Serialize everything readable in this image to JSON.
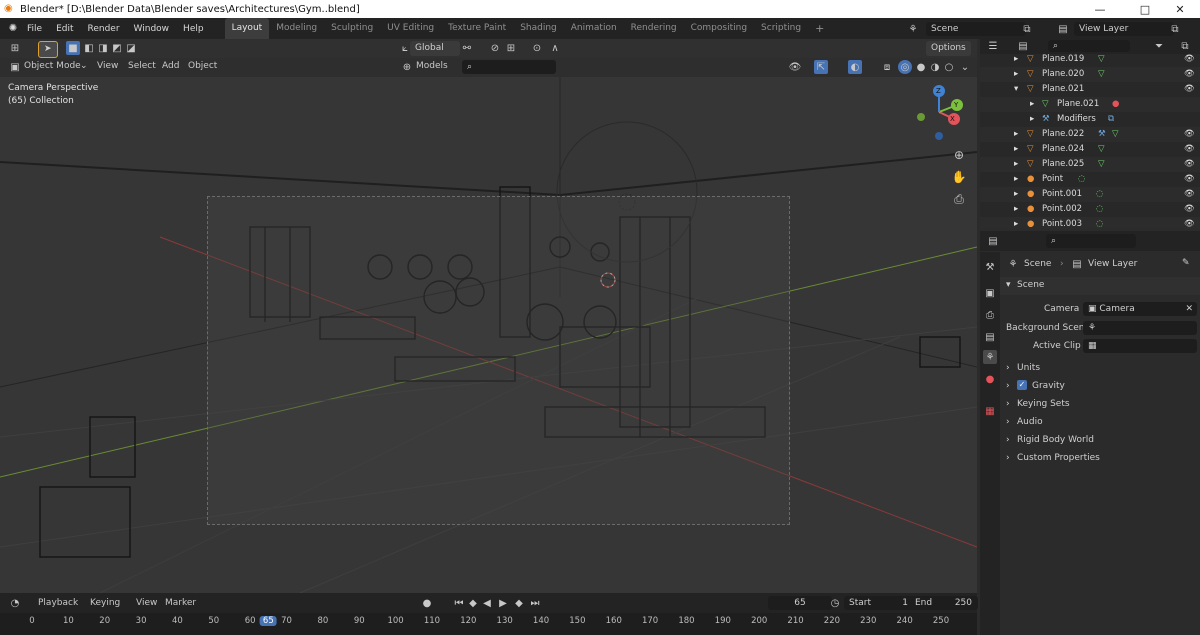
{
  "window": {
    "title": "Blender* [D:\\Blender Data\\Blender saves\\Architectures\\Gym..blend]",
    "min": "—",
    "max": "□",
    "close": "✕"
  },
  "menu": {
    "items": [
      "File",
      "Edit",
      "Render",
      "Window",
      "Help"
    ]
  },
  "workspaces": [
    "Layout",
    "Modeling",
    "Sculpting",
    "UV Editing",
    "Texture Paint",
    "Shading",
    "Animation",
    "Rendering",
    "Compositing",
    "Scripting"
  ],
  "workspace_add": "+",
  "scene": {
    "name": "Scene",
    "view_layer": "View Layer"
  },
  "header": {
    "orientation": "Global",
    "options": "Options",
    "mode": "Object Mode",
    "view": "View",
    "select": "Select",
    "add": "Add",
    "object": "Object",
    "models": "Models"
  },
  "viewport": {
    "perspective": "Camera Perspective",
    "collection": "(65) Collection",
    "gizmo": {
      "x": "X",
      "y": "Y",
      "z": "Z"
    }
  },
  "outliner": {
    "rows": [
      {
        "label": "Plane.019",
        "expand": "▸"
      },
      {
        "label": "Plane.020",
        "expand": "▸"
      },
      {
        "label": "Plane.021",
        "expand": "▾"
      },
      {
        "label": "Plane.021",
        "expand": "▸"
      },
      {
        "label": "Modifiers",
        "expand": "▸"
      },
      {
        "label": "Plane.022",
        "expand": "▸"
      },
      {
        "label": "Plane.024",
        "expand": "▸"
      },
      {
        "label": "Plane.025",
        "expand": "▸"
      },
      {
        "label": "Point",
        "expand": "▸"
      },
      {
        "label": "Point.001",
        "expand": "▸"
      },
      {
        "label": "Point.002",
        "expand": "▸"
      },
      {
        "label": "Point.003",
        "expand": "▸"
      }
    ]
  },
  "properties": {
    "crumb_scene": "Scene",
    "crumb_view_layer": "View Layer",
    "panel_title": "Scene",
    "camera_label": "Camera",
    "camera_value": "Camera",
    "background_label": "Background Scen",
    "active_clip_label": "Active Clip",
    "sections": [
      "Units",
      "Gravity",
      "Keying Sets",
      "Audio",
      "Rigid Body World",
      "Custom Properties"
    ]
  },
  "timeline": {
    "playback": "Playback",
    "keying": "Keying",
    "view": "View",
    "marker": "Marker",
    "current_frame": "65",
    "start_label": "Start",
    "start": "1",
    "end_label": "End",
    "end": "250",
    "ticks": [
      "0",
      "10",
      "20",
      "30",
      "40",
      "50",
      "60",
      "65",
      "70",
      "80",
      "90",
      "100",
      "110",
      "120",
      "130",
      "140",
      "150",
      "160",
      "170",
      "180",
      "190",
      "200",
      "210",
      "220",
      "230",
      "240",
      "250"
    ]
  },
  "colors": {
    "accent": "#4772b3",
    "object_orange": "#e8903a",
    "mesh_green": "#6ed36e",
    "x_axis": "#e2545a",
    "y_axis": "#7cc13c",
    "z_axis": "#3f83d6"
  }
}
